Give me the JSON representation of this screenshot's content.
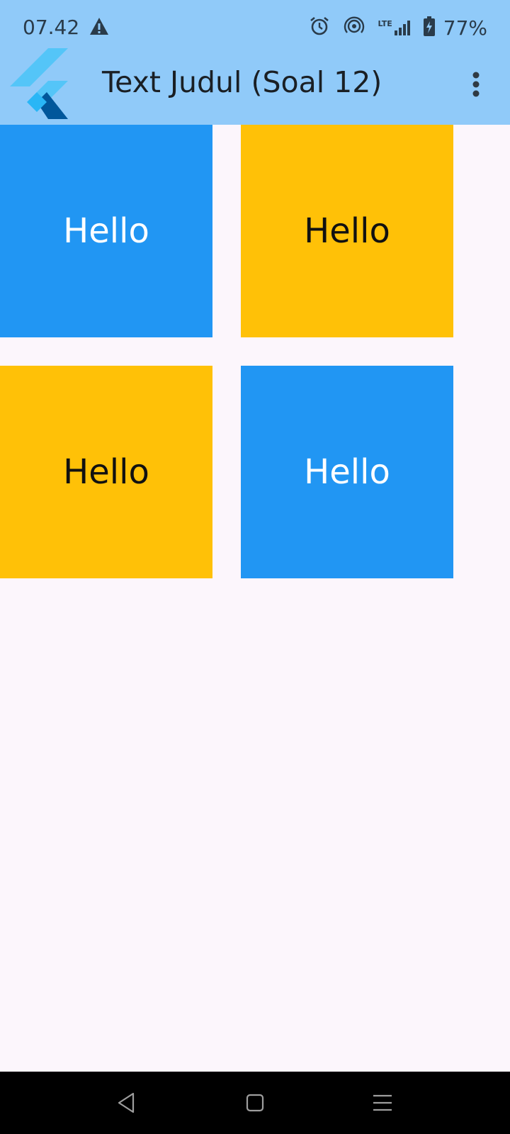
{
  "status_bar": {
    "time": "07.42",
    "network_label": "LTE",
    "battery": "77%"
  },
  "app_bar": {
    "title": "Text Judul (Soal 12)",
    "bg_color": "#90caf9"
  },
  "grid": {
    "tiles": [
      {
        "label": "Hello",
        "color": "#2196f3"
      },
      {
        "label": "Hello",
        "color": "#ffc107"
      },
      {
        "label": "Hello",
        "color": "#ffc107"
      },
      {
        "label": "Hello",
        "color": "#2196f3"
      }
    ]
  },
  "nav_bar": {
    "icons": [
      "back-icon",
      "home-icon",
      "recents-icon"
    ]
  }
}
